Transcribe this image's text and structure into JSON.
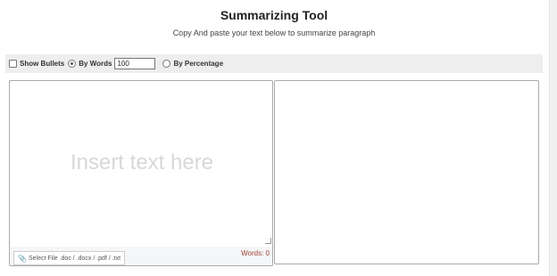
{
  "header": {
    "title": "Summarizing Tool",
    "subtitle": "Copy And paste your text below to summarize paragraph"
  },
  "options": {
    "show_bullets_label": "Show Bullets",
    "by_words_label": "By Words",
    "words_value": "100",
    "by_percentage_label": "By Percentage",
    "selected_mode": "By Words"
  },
  "editor": {
    "placeholder": "Insert text here",
    "select_file_label": "Select File .doc / .docx / .pdf / .txt",
    "words_count": "Words: 0"
  },
  "colors": {
    "toolbar_bg": "#eeeeee",
    "word_count_color": "#a0443a",
    "placeholder_color": "#d8d8d8"
  },
  "icons": {
    "file_button": "paperclip-icon"
  }
}
